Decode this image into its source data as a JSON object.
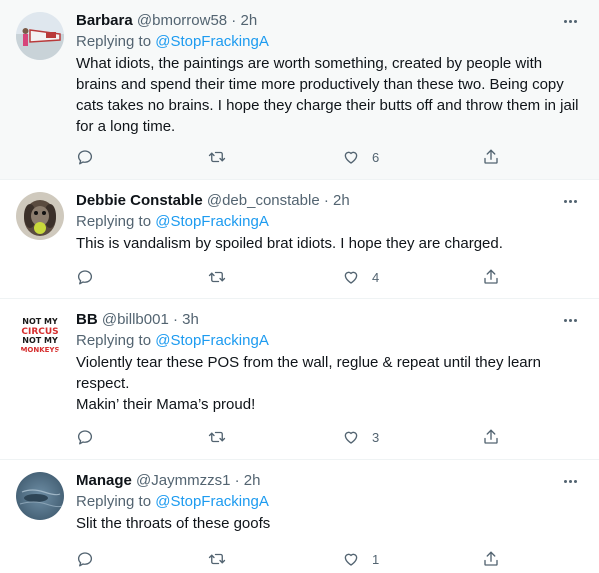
{
  "replies": [
    {
      "name": "Barbara",
      "handle": "@bmorrow58",
      "time": "2h",
      "replying_prefix": "Replying to ",
      "replying_to": "@StopFrackingA",
      "text": "What idiots,  the paintings are worth something, created by people with brains and spend their time more productively than these two. Being copy cats takes no brains. I hope they charge their butts off and throw them in jail for a long time.",
      "likes": "6"
    },
    {
      "name": "Debbie Constable",
      "handle": "@deb_constable",
      "time": "2h",
      "replying_prefix": "Replying to ",
      "replying_to": "@StopFrackingA",
      "text": "This is vandalism by spoiled brat idiots.  I hope they are charged.",
      "likes": "4"
    },
    {
      "name": "BB",
      "handle": "@billb001",
      "time": "3h",
      "replying_prefix": "Replying to ",
      "replying_to": "@StopFrackingA",
      "text_line1": "Violently tear these POS from the wall, reglue & repeat until they learn respect.",
      "text_line2": "Makin’ their Mama’s proud!",
      "likes": "3",
      "avatar_text": [
        "NOT MY",
        "CIRCUS",
        "NOT MY",
        "MONKEYS"
      ]
    },
    {
      "name": "Manage",
      "handle": "@Jaymmzzs1",
      "time": "2h",
      "replying_prefix": "Replying to ",
      "replying_to": "@StopFrackingA",
      "text": "Slit the throats of these goofs",
      "likes": "1"
    }
  ],
  "separator": " · ",
  "colors": {
    "accent": "#1d9bf0",
    "muted": "#536471",
    "text": "#0f1419",
    "highlight_bg": "#f7f9f9",
    "border": "#eff3f4"
  }
}
